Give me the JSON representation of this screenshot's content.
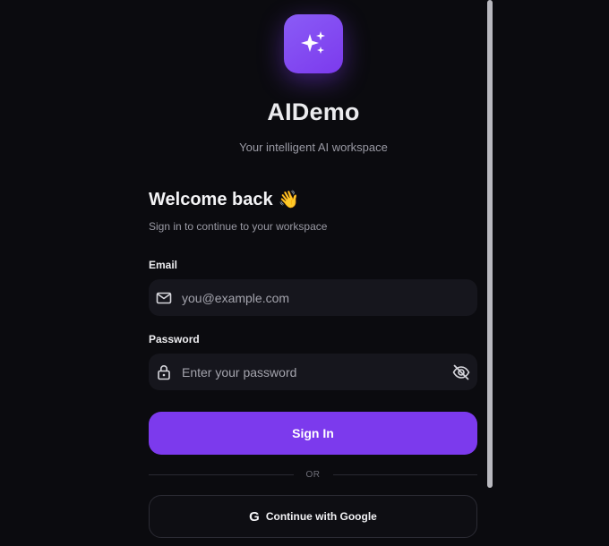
{
  "brand": {
    "logo_icon": "sparkles-icon",
    "name": "AIDemo",
    "tagline": "Your intelligent AI workspace",
    "accent_color": "#7c3aed"
  },
  "login": {
    "heading": "Welcome back",
    "heading_emoji": "👋",
    "subheading": "Sign in to continue to your workspace",
    "email": {
      "label": "Email",
      "placeholder": "you@example.com",
      "value": "",
      "icon": "mail-icon"
    },
    "password": {
      "label": "Password",
      "placeholder": "Enter your password",
      "value": "",
      "icon": "lock-icon",
      "toggle_icon": "eye-off-icon"
    },
    "submit_label": "Sign In",
    "divider_label": "OR",
    "google_button": {
      "icon_glyph": "G",
      "label": "Continue with Google"
    }
  }
}
